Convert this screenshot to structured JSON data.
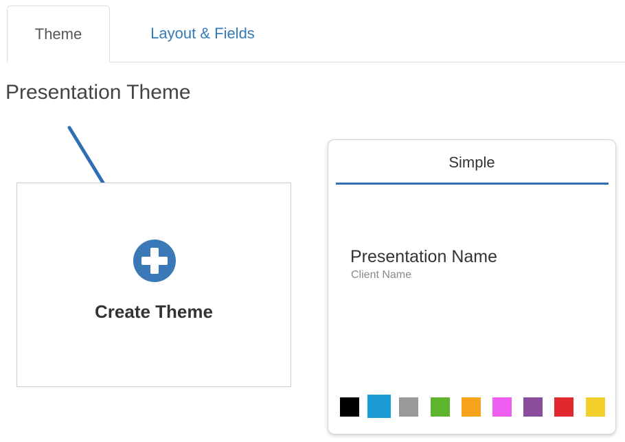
{
  "tabs": [
    {
      "label": "Theme",
      "active": true
    },
    {
      "label": "Layout & Fields",
      "active": false
    }
  ],
  "section_title": "Presentation Theme",
  "create_card": {
    "label": "Create Theme",
    "icon": "plus-circle-icon",
    "accent_color": "#3a78b8"
  },
  "annotation": {
    "icon": "arrow-icon",
    "color": "#2f6db5"
  },
  "theme_card": {
    "name": "Simple",
    "preview": {
      "presentation_name": "Presentation Name",
      "client_name": "Client Name"
    },
    "underline_color": "#2f6db5",
    "swatches": [
      {
        "color": "#000000",
        "selected": false
      },
      {
        "color": "#1c9ad6",
        "selected": true
      },
      {
        "color": "#999999",
        "selected": false
      },
      {
        "color": "#5cb52c",
        "selected": false
      },
      {
        "color": "#f7a21b",
        "selected": false
      },
      {
        "color": "#ef5ef0",
        "selected": false
      },
      {
        "color": "#8a4d9c",
        "selected": false
      },
      {
        "color": "#e0282e",
        "selected": false
      },
      {
        "color": "#f2cf2b",
        "selected": false
      }
    ]
  }
}
